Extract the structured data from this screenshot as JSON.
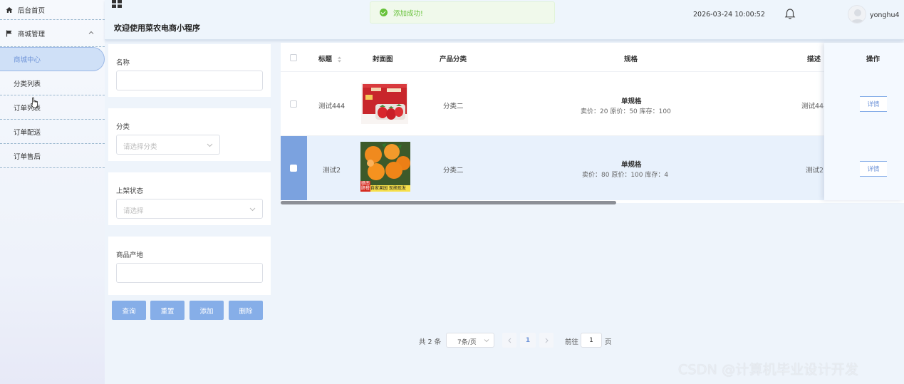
{
  "sidebar": {
    "home_label": "后台首页",
    "group_label": "商城管理",
    "items": [
      {
        "label": "商城中心",
        "active": true
      },
      {
        "label": "分类列表",
        "active": false
      },
      {
        "label": "订单列表",
        "active": false
      },
      {
        "label": "订单配送",
        "active": false
      },
      {
        "label": "订单售后",
        "active": false
      }
    ]
  },
  "header": {
    "title": "欢迎使用菜农电商小程序",
    "datetime": "2026-03-24 10:00:52",
    "username": "yonghu4"
  },
  "toast": {
    "message": "添加成功!",
    "color": "#67c23a"
  },
  "search": {
    "name_label": "名称",
    "name_value": "",
    "category_label": "分类",
    "category_placeholder": "请选择分类",
    "status_label": "上架状态",
    "status_placeholder": "请选择",
    "origin_label": "商品产地",
    "origin_value": "",
    "buttons": {
      "query": "查询",
      "reset": "重置",
      "add": "添加",
      "delete": "删除"
    }
  },
  "table": {
    "columns": {
      "title": "标题",
      "cover": "封面图",
      "category": "产品分类",
      "spec": "规格",
      "desc": "描述",
      "op": "操作"
    },
    "rows": [
      {
        "title": "测试444",
        "category": "分类二",
        "spec_name": "单规格",
        "spec_detail": "卖价：20  原价：50  库存：100",
        "desc": "测试444",
        "op": "详情",
        "cover_icon": "strawberry-box-image",
        "selected": false
      },
      {
        "title": "测试2",
        "category": "分类二",
        "spec_name": "单规格",
        "spec_detail": "卖价：80  原价：100  库存：4",
        "desc": "测试2",
        "op": "详情",
        "cover_icon": "orange-image",
        "cover_caption_left": "赣南 脐橙",
        "cover_caption": "自家果园 现摘现发",
        "selected": true
      }
    ]
  },
  "pagination": {
    "total": "共 2 条",
    "page_size": "7条/页",
    "current_page": "1",
    "goto_prefix": "前往",
    "goto_value": "1",
    "goto_suffix": "页"
  },
  "watermark": "CSDN @计算机毕业设计开发",
  "accent_color": "#86aee8"
}
